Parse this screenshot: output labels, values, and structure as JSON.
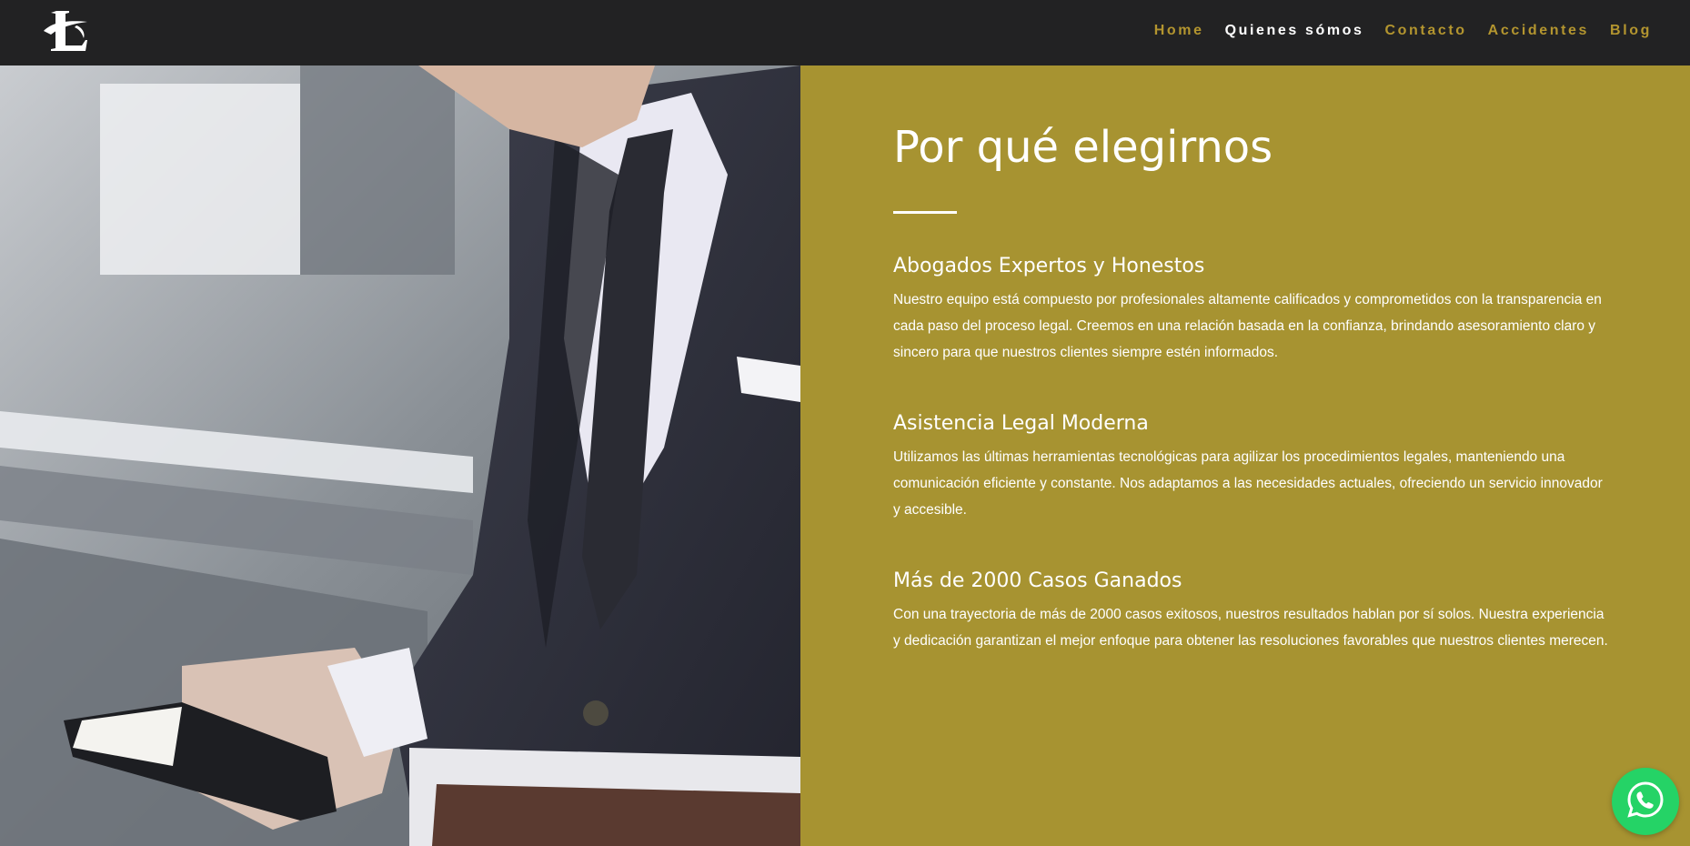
{
  "header": {
    "logo_icon": "law-firm-logo-icon",
    "nav": [
      {
        "label": "Home",
        "active": false
      },
      {
        "label": "Quienes sómos",
        "active": true
      },
      {
        "label": "Contacto",
        "active": false
      },
      {
        "label": "Accidentes",
        "active": false
      },
      {
        "label": "Blog",
        "active": false
      }
    ]
  },
  "hero": {
    "photo_icon": "businessman-with-phone-photo"
  },
  "panel": {
    "title": "Por qué elegirnos",
    "features": [
      {
        "heading": "Abogados Expertos y Honestos",
        "text": "Nuestro equipo está compuesto por profesionales altamente calificados y comprometidos con la transparencia en cada paso del proceso legal. Creemos en una relación basada en la confianza, brindando asesoramiento claro y sincero para que nuestros clientes siempre estén informados."
      },
      {
        "heading": "Asistencia Legal Moderna",
        "text": "Utilizamos las últimas herramientas tecnológicas para agilizar los procedimientos legales, manteniendo una comunicación eficiente y constante. Nos adaptamos a las necesidades actuales, ofreciendo un servicio innovador y accesible."
      },
      {
        "heading": "Más de 2000 Casos Ganados",
        "text": "Con una trayectoria de más de 2000 casos exitosos, nuestros resultados hablan por sí solos. Nuestra experiencia y dedicación garantizan el mejor enfoque para obtener las resoluciones favorables que nuestros clientes merecen."
      }
    ]
  },
  "floating": {
    "whatsapp_icon": "whatsapp-icon"
  },
  "colors": {
    "header_bg": "#222223",
    "accent_gold": "#b3952f",
    "panel_bg": "#a79331",
    "whatsapp_green": "#25d366"
  }
}
